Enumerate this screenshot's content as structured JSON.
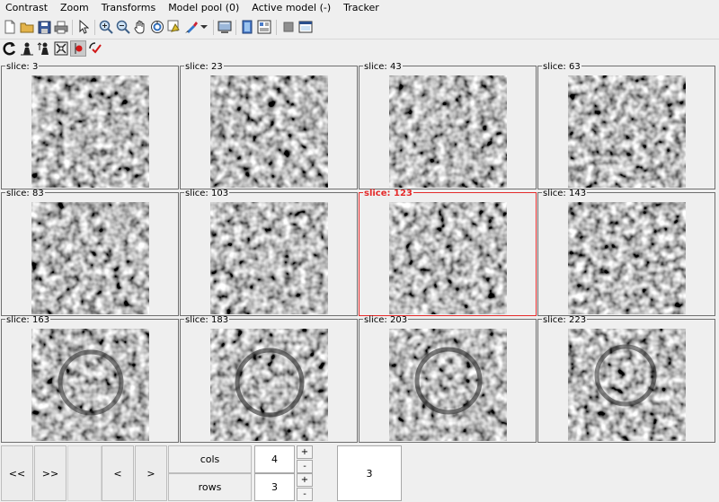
{
  "menu": [
    "Contrast",
    "Zoom",
    "Transforms",
    "Model pool (0)",
    "Active model (-)",
    "Tracker"
  ],
  "toolbar1_icons": [
    "new-icon",
    "open-icon",
    "save-icon",
    "print-icon",
    "pointer-icon",
    "zoom-in-icon",
    "zoom-out-icon",
    "pan-hand-icon",
    "rotate-icon",
    "model-icon",
    "paint-brush-icon",
    "dropdown-arrow-icon",
    "screen-icon",
    "panel-icon",
    "layout-icon",
    "stop-icon",
    "window-icon"
  ],
  "toolbar2_icons": [
    "refresh-icon",
    "figure-icon",
    "figure-up-icon",
    "crosshair-icon",
    "record-dot-icon",
    "apply-icon"
  ],
  "slices": [
    {
      "label": "slice: 3"
    },
    {
      "label": "slice: 23"
    },
    {
      "label": "slice: 43"
    },
    {
      "label": "slice: 63"
    },
    {
      "label": "slice: 83"
    },
    {
      "label": "slice: 103"
    },
    {
      "label": "slice: 123",
      "selected": true
    },
    {
      "label": "slice: 143"
    },
    {
      "label": "slice: 163"
    },
    {
      "label": "slice: 183"
    },
    {
      "label": "slice: 203"
    },
    {
      "label": "slice: 223"
    }
  ],
  "nav": {
    "first": "<<",
    "next_page": ">>",
    "prev": "<",
    "next": ">"
  },
  "cols": {
    "label": "cols",
    "value": "4"
  },
  "rows": {
    "label": "rows",
    "value": "3"
  },
  "stepper": {
    "plus": "+",
    "minus": "-"
  },
  "page_display": "3",
  "colors": {
    "selected_border": "#e52b2b",
    "cell_border": "#6f6f6f",
    "background": "#efefef"
  }
}
